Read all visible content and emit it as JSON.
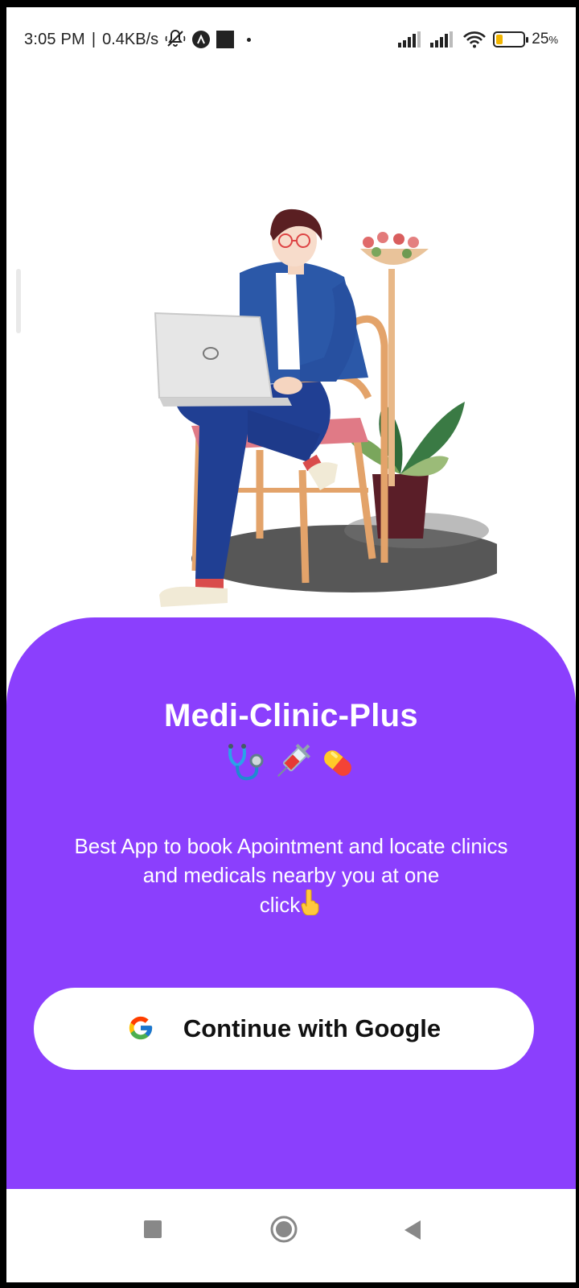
{
  "status_bar": {
    "time": "3:05 PM",
    "separator": "|",
    "speed": "0.4KB/s",
    "battery_percent": "25",
    "battery_unit": "%",
    "battery_level": 0.25,
    "icons": [
      "mute-vibrate-icon",
      "app-a-icon",
      "square-notification-icon",
      "dot-icon",
      "signal-icon",
      "signal-icon",
      "wifi-icon",
      "battery-icon"
    ]
  },
  "hero": {
    "illustration": "man-with-laptop-illustration"
  },
  "card": {
    "title": "Medi-Clinic-Plus",
    "emoji_icons": [
      "stethoscope-icon",
      "syringe-icon",
      "pill-icon"
    ],
    "tagline_line1": "Best App to book Apointment and locate clinics",
    "tagline_line2": "and medicals nearby you at one",
    "tagline_line3": "click",
    "tagline_emoji": "pointing-hand-icon",
    "color": "#8b3ffd"
  },
  "google_button": {
    "label": "Continue with Google",
    "icon": "google-icon"
  },
  "nav_bar": {
    "buttons": [
      "recents-button",
      "home-button",
      "back-button"
    ]
  }
}
